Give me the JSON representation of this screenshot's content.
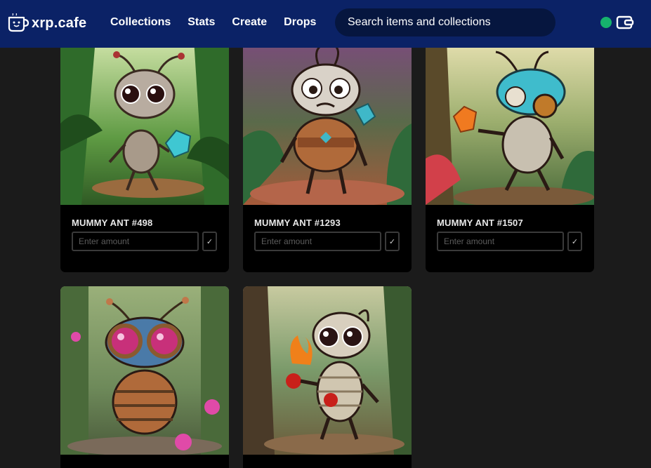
{
  "header": {
    "brand": "xrp.cafe",
    "nav": [
      "Collections",
      "Stats",
      "Create",
      "Drops"
    ],
    "search_placeholder": "Search items and collections",
    "status_color": "#16b36d"
  },
  "theme": {
    "header_bg": "#0b2266",
    "page_bg": "#1b1b1b",
    "card_bg": "#000000"
  },
  "cards": [
    {
      "title": "MUMMY ANT #498",
      "placeholder": "Enter amount",
      "confirm": "✓",
      "image_subject": "grey bandaged ant holding cyan gem in rainy jungle"
    },
    {
      "title": "MUMMY ANT #1293",
      "placeholder": "Enter amount",
      "confirm": "✓",
      "image_subject": "armored mummy ant with teal gems in purple forest"
    },
    {
      "title": "MUMMY ANT #1507",
      "placeholder": "Enter amount",
      "confirm": "✓",
      "image_subject": "cyan-headed ant holding orange gem in jungle"
    },
    {
      "title": "",
      "placeholder": "",
      "confirm": "",
      "image_subject": "blue ant with pink goggle eyes and pink orbs"
    },
    {
      "title": "",
      "placeholder": "",
      "confirm": "",
      "image_subject": "bandaged mummy ant holding fire and red orb"
    }
  ]
}
